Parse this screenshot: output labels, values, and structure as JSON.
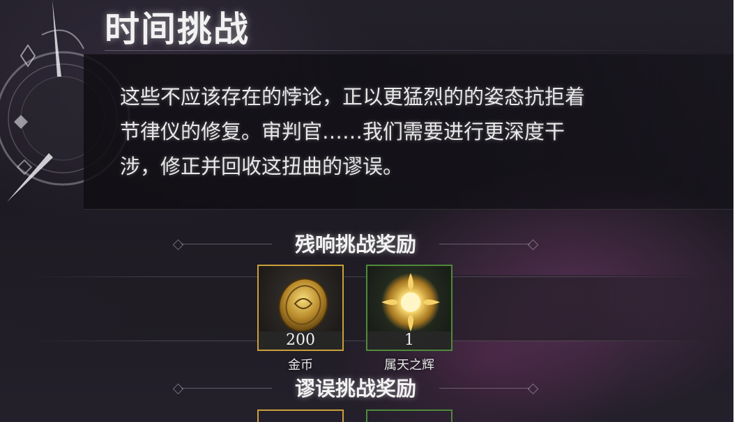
{
  "title": "时间挑战",
  "description": {
    "lines": [
      "这些不应该存在的悖论，正以更猛烈的的姿态抗拒着",
      "节律仪的修复。审判官……我们需要进行更深度干",
      "涉，修正并回收这扭曲的谬误。"
    ]
  },
  "sections": [
    {
      "label": "残响挑战奖励",
      "rewards": [
        {
          "name": "金币",
          "quantity": "200",
          "icon": "gold-coin-icon",
          "rarity_color": "#c9a03a"
        },
        {
          "name": "属天之辉",
          "quantity": "1",
          "icon": "celestial-radiance-icon",
          "rarity_color": "#4f8a3a"
        }
      ]
    },
    {
      "label": "谬误挑战奖励"
    }
  ]
}
